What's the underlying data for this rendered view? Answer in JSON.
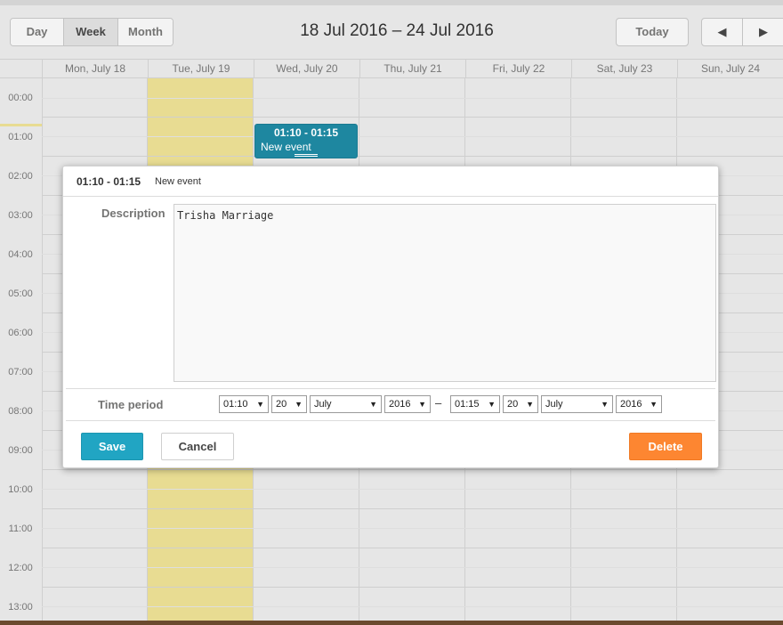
{
  "nav": {
    "views": [
      {
        "label": "Day",
        "active": false
      },
      {
        "label": "Week",
        "active": true
      },
      {
        "label": "Month",
        "active": false
      }
    ],
    "date_range": "18 Jul 2016 – 24 Jul 2016",
    "today_label": "Today",
    "prev_icon": "◀",
    "next_icon": "▶"
  },
  "days": [
    "Mon, July 18",
    "Tue, July 19",
    "Wed, July 20",
    "Thu, July 21",
    "Fri, July 22",
    "Sat, July 23",
    "Sun, July 24"
  ],
  "hours": [
    "00:00",
    "01:00",
    "02:00",
    "03:00",
    "04:00",
    "05:00",
    "06:00",
    "07:00",
    "08:00",
    "09:00",
    "10:00",
    "11:00",
    "12:00",
    "13:00"
  ],
  "event": {
    "time": "01:10 - 01:15",
    "title": "New event",
    "color": "#1e87a0"
  },
  "lightbox": {
    "header_time": "01:10 - 01:15",
    "header_title": "New event",
    "description_label": "Description",
    "description_value": "Trisha Marriage",
    "time_period_label": "Time period",
    "start": {
      "time": "01:10",
      "day": "20",
      "month": "July",
      "year": "2016"
    },
    "separator": "–",
    "end": {
      "time": "01:15",
      "day": "20",
      "month": "July",
      "year": "2016"
    },
    "save_label": "Save",
    "cancel_label": "Cancel",
    "delete_label": "Delete"
  },
  "colors": {
    "today_column": "#e8dc92",
    "save": "#21a5c3",
    "delete": "#fd8631"
  }
}
